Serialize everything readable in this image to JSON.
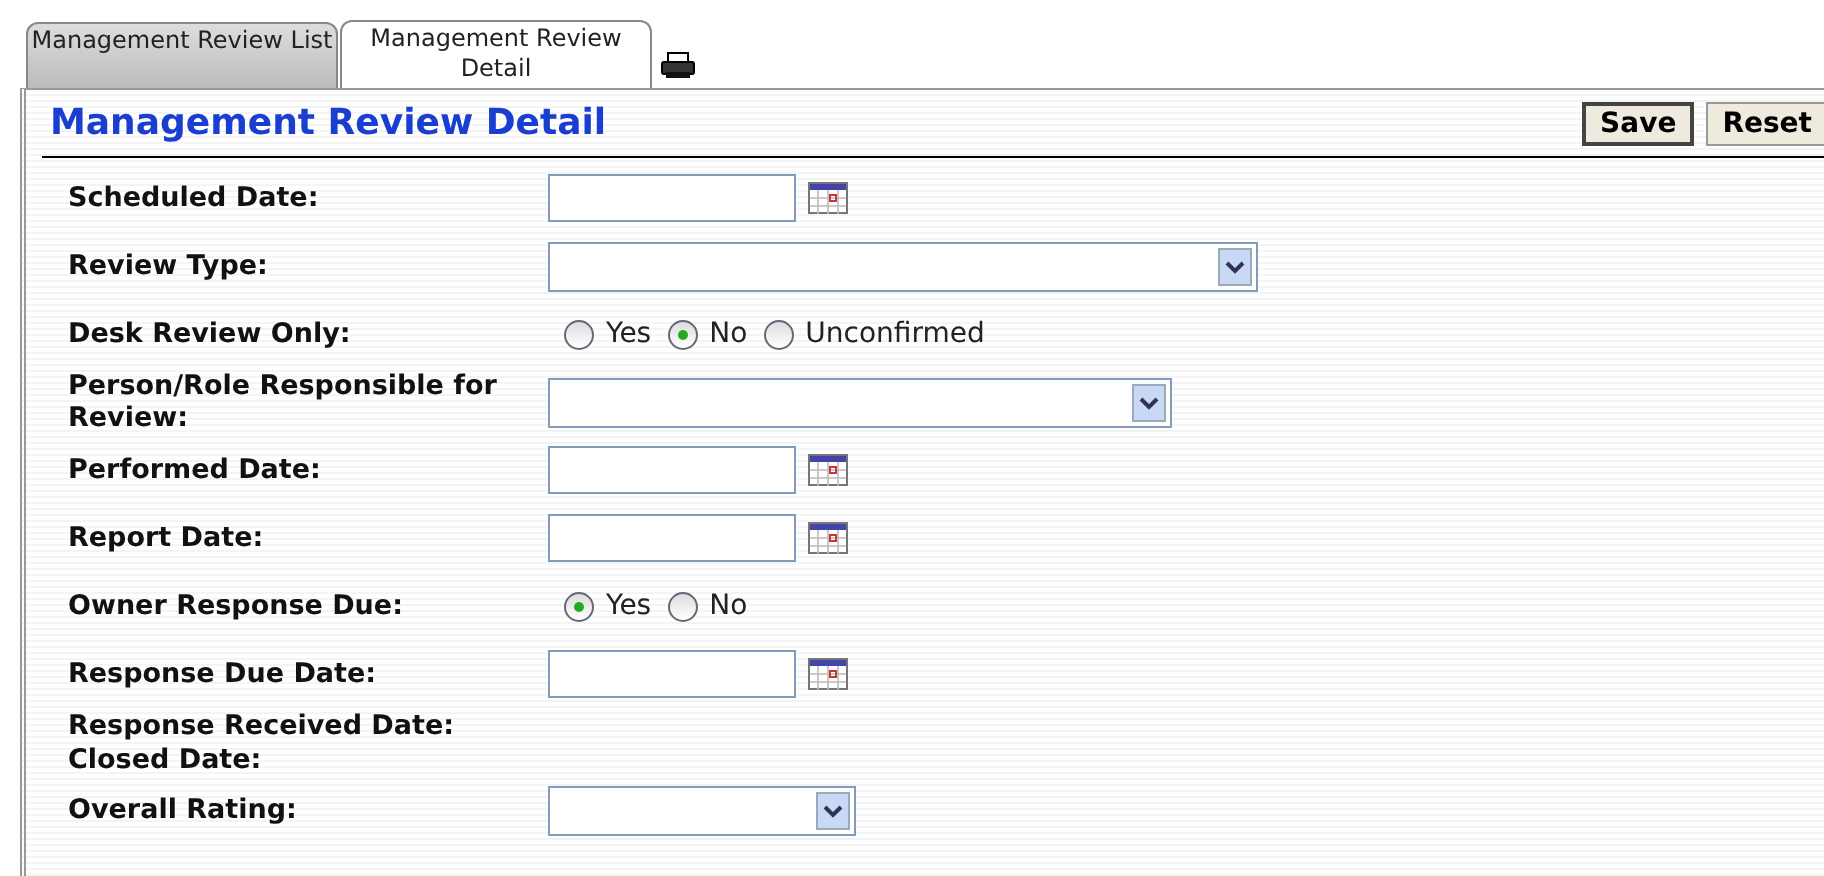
{
  "tabs": [
    {
      "label": "Management Review List",
      "selected": false
    },
    {
      "label": "Management Review Detail",
      "selected": true
    }
  ],
  "title": "Management Review Detail",
  "buttons": [
    "Save",
    "Reset"
  ],
  "fields": [
    {
      "label": "Scheduled Date:",
      "kind": "date"
    },
    {
      "label": "Review Type:",
      "kind": "select"
    },
    {
      "label": "Desk Review Only:",
      "kind": "radio",
      "options": [
        {
          "label": "Yes",
          "selected": false
        },
        {
          "label": "No",
          "selected": true
        },
        {
          "label": "Unconfirmed",
          "selected": false
        }
      ]
    },
    {
      "label": "Person/Role Responsible for Review:",
      "kind": "select"
    },
    {
      "label": "Performed Date:",
      "kind": "date"
    },
    {
      "label": "Report Date:",
      "kind": "date"
    },
    {
      "label": "Owner Response Due:",
      "kind": "radio",
      "options": [
        {
          "label": "Yes",
          "selected": true
        },
        {
          "label": "No",
          "selected": false
        }
      ]
    },
    {
      "label": "Response Due Date:",
      "kind": "date"
    },
    {
      "label": "Response Received Date:",
      "kind": "text"
    },
    {
      "label": "Closed Date:",
      "kind": "text"
    },
    {
      "label": "Overall Rating:",
      "kind": "select"
    }
  ]
}
